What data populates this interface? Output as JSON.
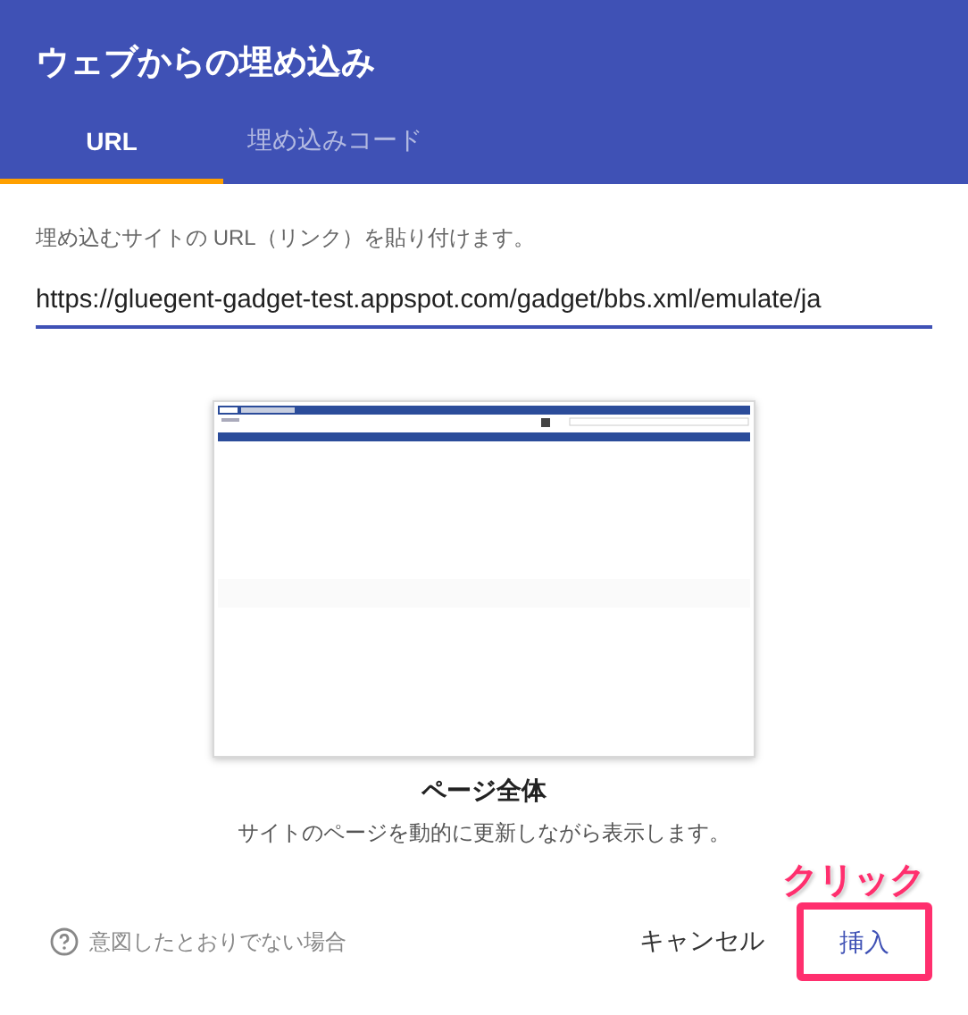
{
  "dialog": {
    "title": "ウェブからの埋め込み"
  },
  "tabs": [
    {
      "label": "URL",
      "selected": true
    },
    {
      "label": "埋め込みコード",
      "selected": false
    }
  ],
  "url_field": {
    "label": "埋め込むサイトの URL（リンク）を貼り付けます。",
    "value": "https://gluegent-gadget-test.appspot.com/gadget/bbs.xml/emulate/ja"
  },
  "preview": {
    "title": "ページ全体",
    "description": "サイトのページを動的に更新しながら表示します。"
  },
  "annotation": {
    "text": "クリック"
  },
  "footer": {
    "help_link": "意図したとおりでない場合",
    "buttons": [
      {
        "label": "キャンセル",
        "kind": "flat",
        "highlighted": false
      },
      {
        "label": "挿入",
        "kind": "primary",
        "highlighted": true
      }
    ]
  }
}
